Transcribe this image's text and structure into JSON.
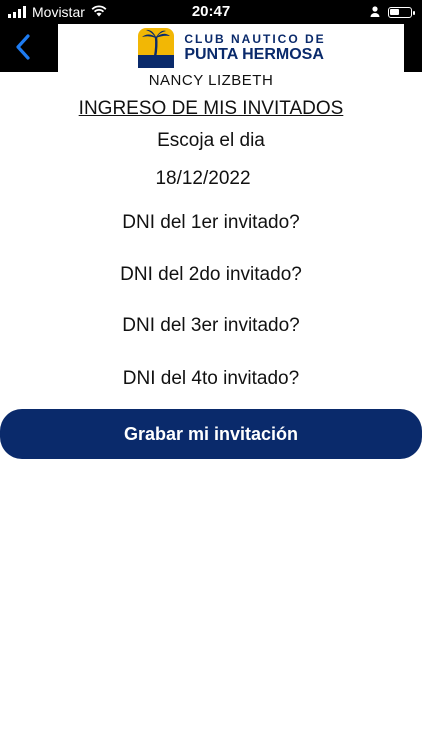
{
  "status_bar": {
    "carrier": "Movistar",
    "time": "20:47",
    "battery_level": 0.45
  },
  "header": {
    "logo_line1": "CLUB NAUTICO DE",
    "logo_line2": "PUNTA HERMOSA",
    "back_icon": "chevron-left-icon"
  },
  "form": {
    "user_name": "NANCY LIZBETH",
    "title": "INGRESO DE MIS INVITADOS",
    "choose_day_label": "Escoja el dia",
    "date_value": "18/12/2022",
    "dni_fields": [
      "DNI del 1er invitado?",
      "DNI del 2do invitado?",
      "DNI del 3er invitado?",
      "DNI del 4to invitado?"
    ],
    "save_label": "Grabar mi invitación"
  },
  "colors": {
    "brand_navy": "#0a2a6b",
    "logo_yellow": "#f2b705",
    "back_blue": "#1e7cf2"
  }
}
